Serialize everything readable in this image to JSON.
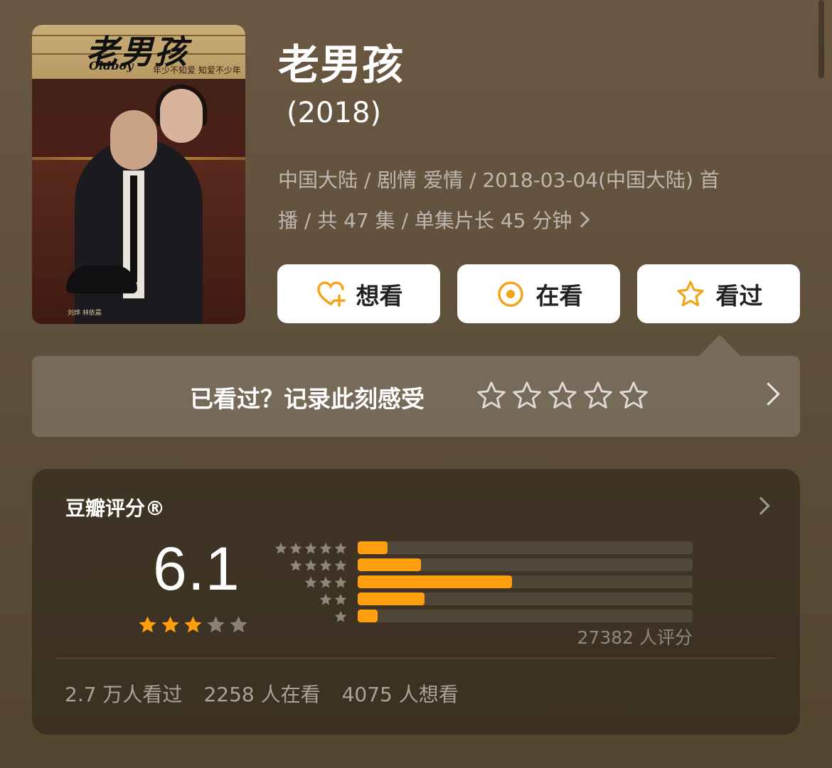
{
  "poster": {
    "title_art": "老男孩",
    "english_art": "Oldboy",
    "tagline": "年少不知爱 知爱不少年",
    "credits": "刘烨 林依晨"
  },
  "header": {
    "title": "老男孩",
    "year": "(2018)",
    "meta_line1": "中国大陆 / 剧情 爱情 / 2018-03-04(中国大陆) 首",
    "meta_line2": "播 / 共 47 集 / 单集片长 45 分钟"
  },
  "actions": {
    "want_label": "想看",
    "watching_label": "在看",
    "watched_label": "看过"
  },
  "record": {
    "prompt": "已看过？记录此刻感受"
  },
  "rating": {
    "title": "豆瓣评分®",
    "score": "6.1",
    "score_stars": 3,
    "distribution": [
      {
        "stars": 5,
        "fraction": 0.09
      },
      {
        "stars": 4,
        "fraction": 0.19
      },
      {
        "stars": 3,
        "fraction": 0.46
      },
      {
        "stars": 2,
        "fraction": 0.2
      },
      {
        "stars": 1,
        "fraction": 0.06
      }
    ],
    "raters": "27382 人评分",
    "watched": "2.7 万人看过",
    "watching": "2258 人在看",
    "wanted": "4075 人想看"
  },
  "colors": {
    "accent": "#ff9f10",
    "star_empty": "#8a8278",
    "background": "#5e4f3b"
  }
}
